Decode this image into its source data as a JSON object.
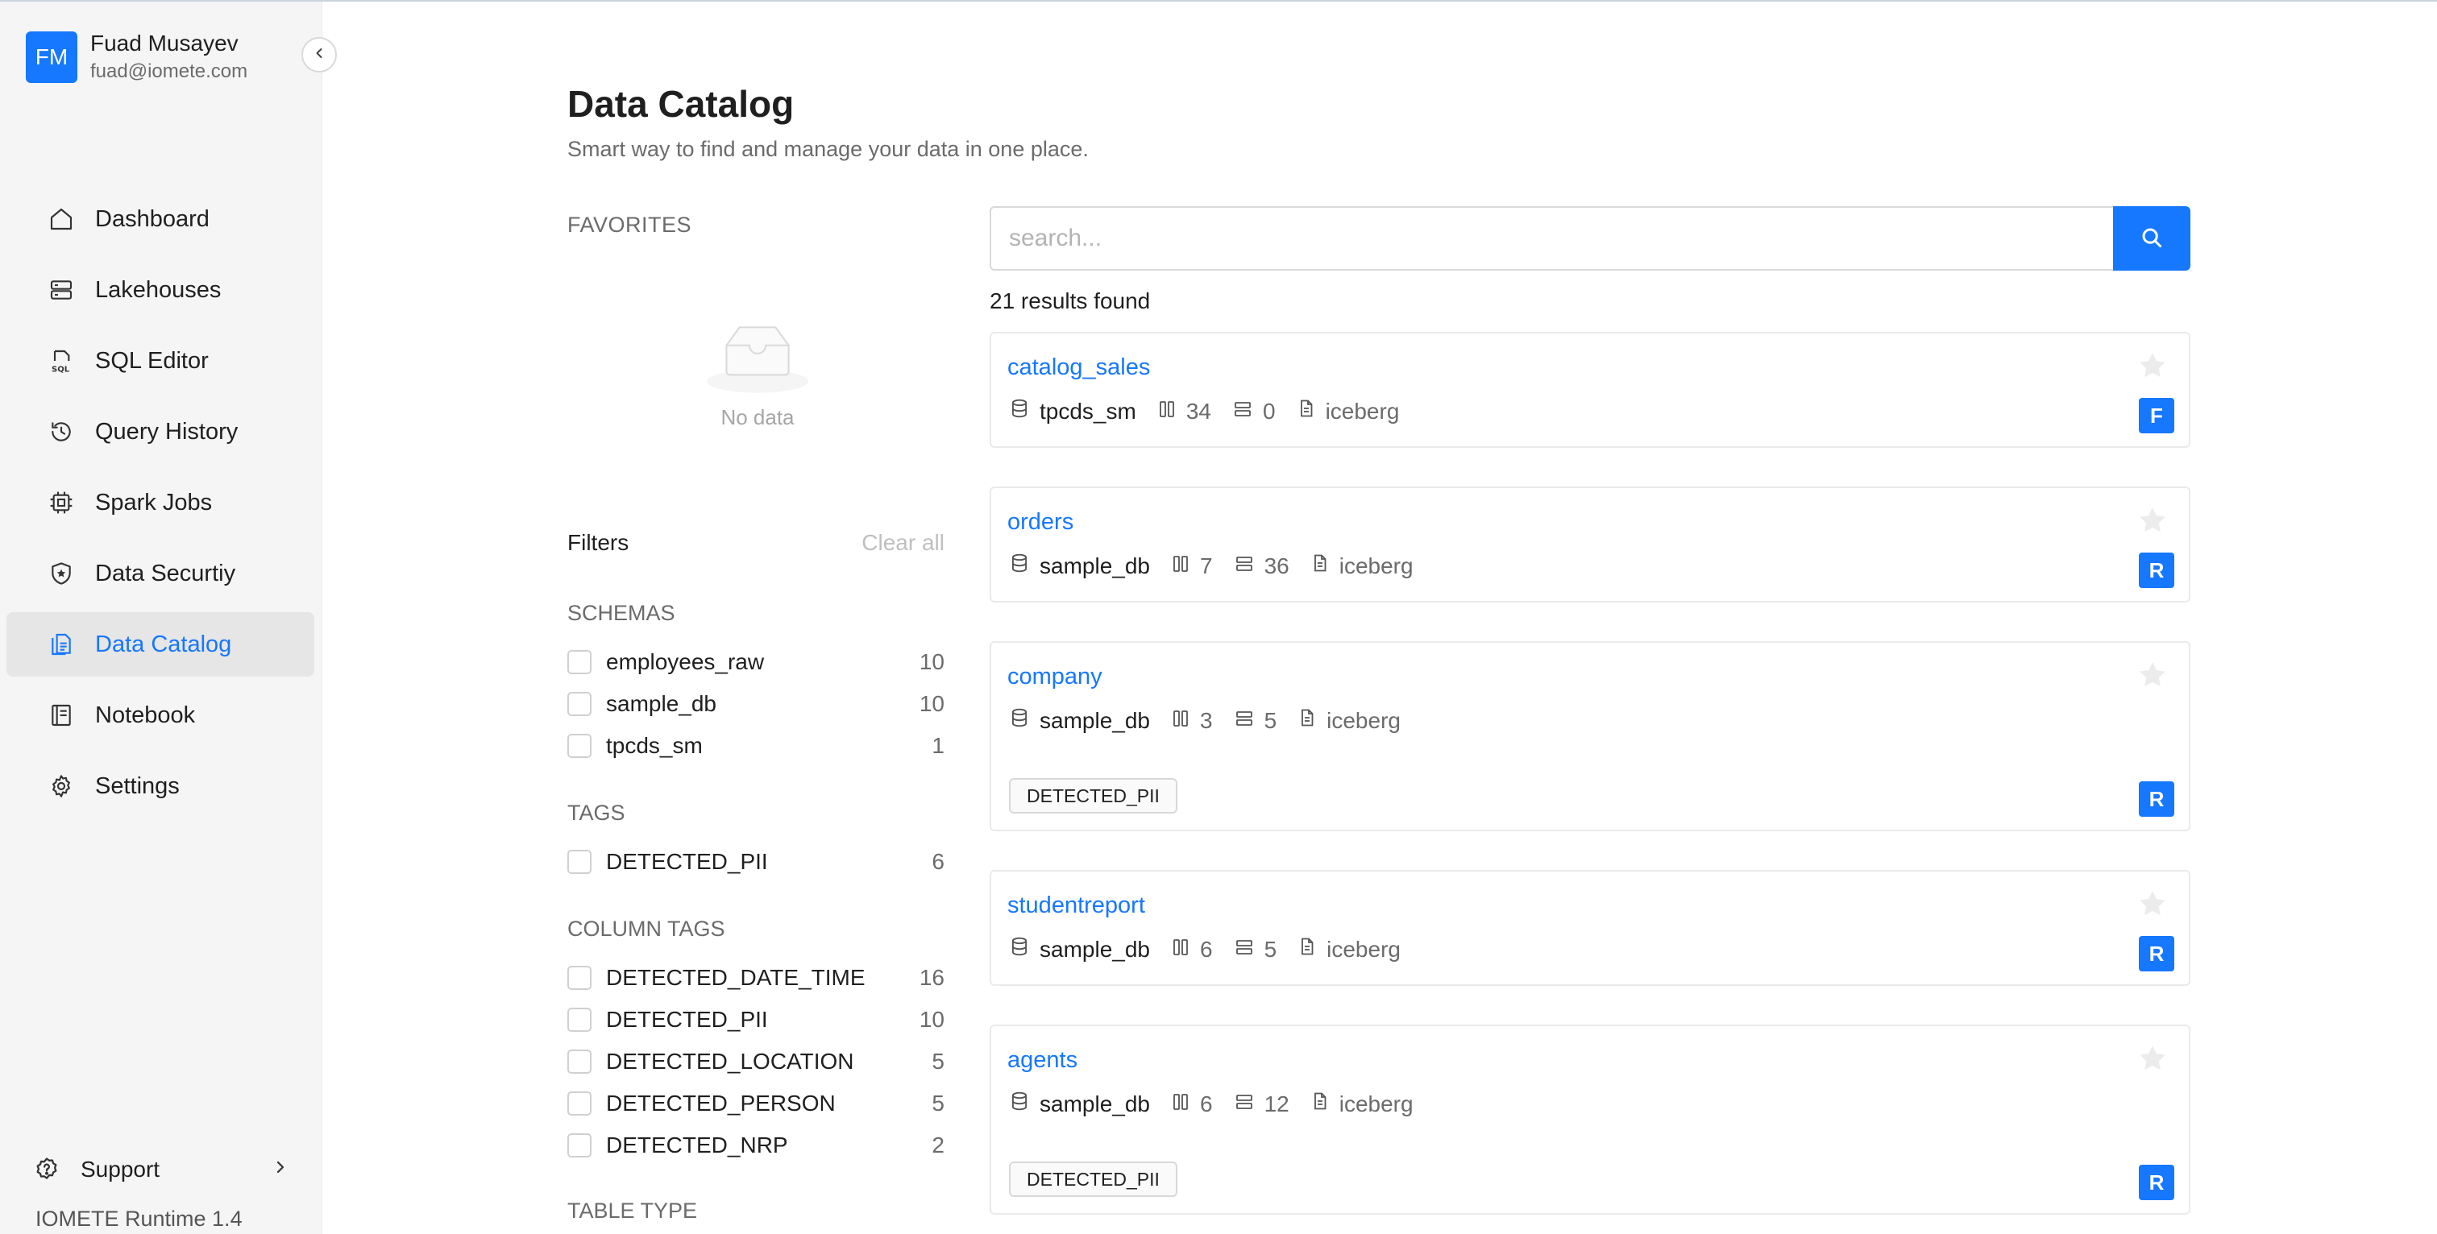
{
  "user": {
    "initials": "FM",
    "name": "Fuad Musayev",
    "email": "fuad@iomete.com"
  },
  "nav": {
    "items": [
      {
        "label": "Dashboard",
        "icon": "home-icon"
      },
      {
        "label": "Lakehouses",
        "icon": "server-icon"
      },
      {
        "label": "SQL Editor",
        "icon": "sql-file-icon"
      },
      {
        "label": "Query History",
        "icon": "history-icon"
      },
      {
        "label": "Spark Jobs",
        "icon": "chip-icon"
      },
      {
        "label": "Data Securtiy",
        "icon": "shield-icon"
      },
      {
        "label": "Data Catalog",
        "icon": "catalog-icon",
        "active": true
      },
      {
        "label": "Notebook",
        "icon": "notebook-icon"
      },
      {
        "label": "Settings",
        "icon": "gear-icon"
      }
    ],
    "support_label": "Support",
    "runtime": "IOMETE Runtime 1.4"
  },
  "page": {
    "title": "Data Catalog",
    "subtitle": "Smart way to find and manage your data in one place."
  },
  "favorites": {
    "label": "FAVORITES",
    "empty_text": "No data"
  },
  "filters": {
    "title": "Filters",
    "clear_all": "Clear all",
    "schemas": {
      "label": "SCHEMAS",
      "items": [
        {
          "name": "employees_raw",
          "count": "10"
        },
        {
          "name": "sample_db",
          "count": "10"
        },
        {
          "name": "tpcds_sm",
          "count": "1"
        }
      ]
    },
    "tags": {
      "label": "TAGS",
      "items": [
        {
          "name": "DETECTED_PII",
          "count": "6"
        }
      ]
    },
    "column_tags": {
      "label": "COLUMN TAGS",
      "items": [
        {
          "name": "DETECTED_DATE_TIME",
          "count": "16"
        },
        {
          "name": "DETECTED_PII",
          "count": "10"
        },
        {
          "name": "DETECTED_LOCATION",
          "count": "5"
        },
        {
          "name": "DETECTED_PERSON",
          "count": "5"
        },
        {
          "name": "DETECTED_NRP",
          "count": "2"
        }
      ]
    },
    "table_type_label": "TABLE TYPE"
  },
  "search": {
    "placeholder": "search...",
    "value": ""
  },
  "results_text": "21 results found",
  "results": [
    {
      "name": "catalog_sales",
      "schema": "tpcds_sm",
      "columns": "34",
      "rows": "0",
      "format": "iceberg",
      "tag": "",
      "badge": "F"
    },
    {
      "name": "orders",
      "schema": "sample_db",
      "columns": "7",
      "rows": "36",
      "format": "iceberg",
      "tag": "",
      "badge": "R"
    },
    {
      "name": "company",
      "schema": "sample_db",
      "columns": "3",
      "rows": "5",
      "format": "iceberg",
      "tag": "DETECTED_PII",
      "badge": "R"
    },
    {
      "name": "studentreport",
      "schema": "sample_db",
      "columns": "6",
      "rows": "5",
      "format": "iceberg",
      "tag": "",
      "badge": "R"
    },
    {
      "name": "agents",
      "schema": "sample_db",
      "columns": "6",
      "rows": "12",
      "format": "iceberg",
      "tag": "DETECTED_PII",
      "badge": "R"
    }
  ],
  "colors": {
    "accent": "#1677ff",
    "sidebar_bg": "#f5f5f5",
    "active_bg": "#e6e6e6"
  }
}
